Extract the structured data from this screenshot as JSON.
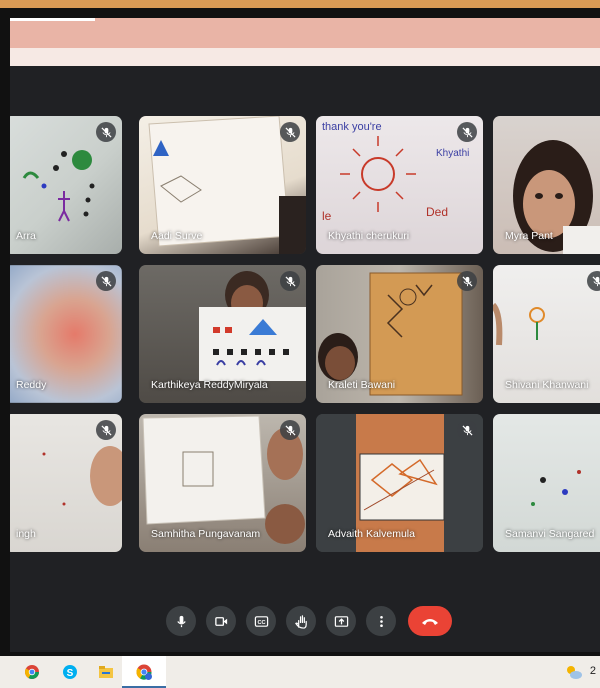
{
  "participants": [
    {
      "name": "Arra"
    },
    {
      "name": "Aadi Surve"
    },
    {
      "name": "Khyathi cherukuri"
    },
    {
      "name": "Myra Pant"
    },
    {
      "name": "Reddy"
    },
    {
      "name": "Karthikeya ReddyMiryala"
    },
    {
      "name": "Kraleti Bawani"
    },
    {
      "name": "Shivani Khanwani"
    },
    {
      "name": "ingh"
    },
    {
      "name": "Samhitha Pungavanam"
    },
    {
      "name": "Advaith Kalvemula"
    },
    {
      "name": "Samanvi Sangared"
    }
  ],
  "controls": {
    "items": [
      "mic-icon",
      "camera-icon",
      "captions-icon",
      "raise-hand-icon",
      "present-icon",
      "more-options-icon",
      "end-call-icon"
    ],
    "captions_label": "CC"
  },
  "taskbar": {
    "icons": [
      "chrome-icon",
      "skype-icon",
      "file-explorer-icon",
      "chrome-profile-icon"
    ],
    "weather_text": "2"
  },
  "colors": {
    "meet_bg": "#202124",
    "tile_bg": "#3c4043",
    "hangup": "#ea4335"
  }
}
